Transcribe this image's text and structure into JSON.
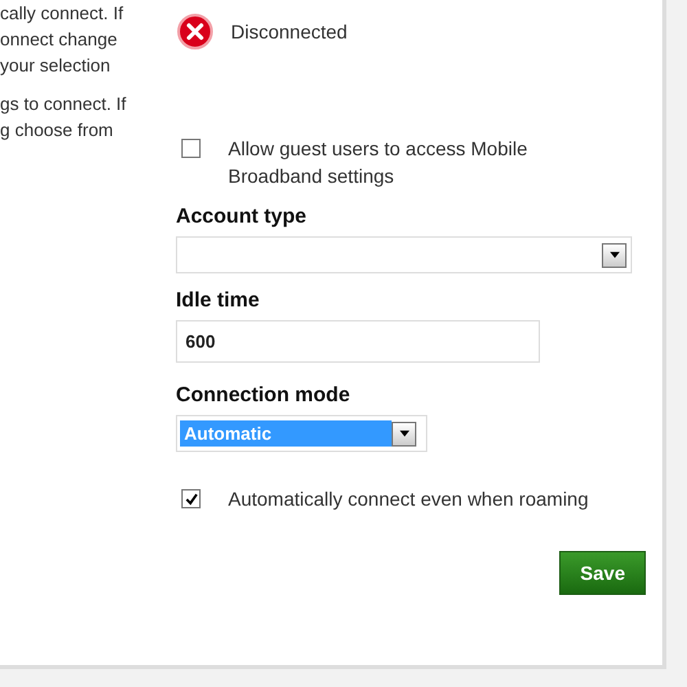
{
  "help_text": [
    [
      "cally connect. If",
      "onnect change",
      "your selection"
    ],
    [
      "gs to connect. If",
      "g choose from"
    ]
  ],
  "status": {
    "kind": "error",
    "label": "Disconnected"
  },
  "guest_access": {
    "label": "Allow guest users to access Mobile Broadband settings",
    "checked": false
  },
  "account_type": {
    "label": "Account type"
  },
  "idle_time": {
    "label": "Idle time",
    "value": "600"
  },
  "connection_mode": {
    "label": "Connection mode",
    "value": "Automatic"
  },
  "roaming": {
    "label": "Automatically connect even when roaming",
    "checked": true
  },
  "save_button": "Save"
}
